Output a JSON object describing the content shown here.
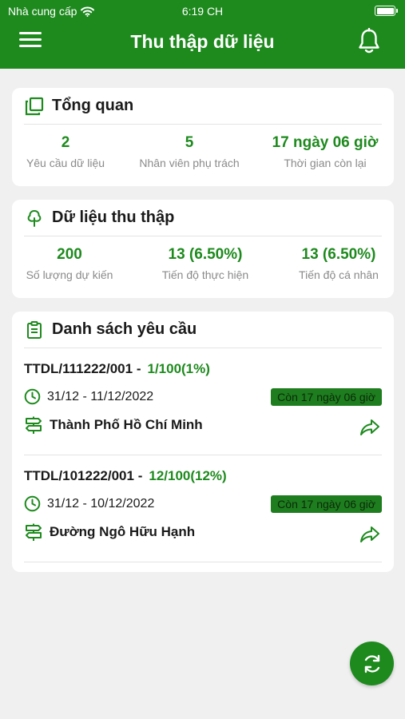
{
  "status_bar": {
    "carrier": "Nhà cung cấp",
    "time": "6:19 CH",
    "wifi_icon": "wifi-icon",
    "battery_icon": "battery-icon"
  },
  "header": {
    "title": "Thu thập dữ liệu",
    "menu_icon": "hamburger-menu-icon",
    "bell_icon": "bell-icon",
    "background_color": "#1e8a1e"
  },
  "overview": {
    "title": "Tổng quan",
    "icon": "copy-icon",
    "stats": [
      {
        "value": "2",
        "label": "Yêu cầu dữ liệu"
      },
      {
        "value": "5",
        "label": "Nhân viên phụ trách"
      },
      {
        "value": "17 ngày 06 giờ",
        "label": "Thời gian còn lại"
      }
    ]
  },
  "collected": {
    "title": "Dữ liệu thu thập",
    "icon": "tree-icon",
    "stats": [
      {
        "value": "200",
        "label": "Số lượng dự kiến"
      },
      {
        "value": "13 (6.50%)",
        "label": "Tiến độ thực hiện"
      },
      {
        "value": "13 (6.50%)",
        "label": "Tiến độ cá nhân"
      }
    ]
  },
  "requests": {
    "title": "Danh sách yêu cầu",
    "icon": "clipboard-icon",
    "items": [
      {
        "code": "TTDL/111222/001 -",
        "progress": "1/100(1%)",
        "date_range": "31/12 - 11/12/2022",
        "remaining": "Còn 17 ngày 06 giờ",
        "place": "Thành Phố Hồ Chí Minh"
      },
      {
        "code": "TTDL/101222/001 -",
        "progress": "12/100(12%)",
        "date_range": "31/12 - 10/12/2022",
        "remaining": "Còn 17 ngày 06 giờ",
        "place": "Đường Ngô Hữu Hạnh"
      }
    ]
  },
  "fab": {
    "icon": "refresh-icon"
  }
}
